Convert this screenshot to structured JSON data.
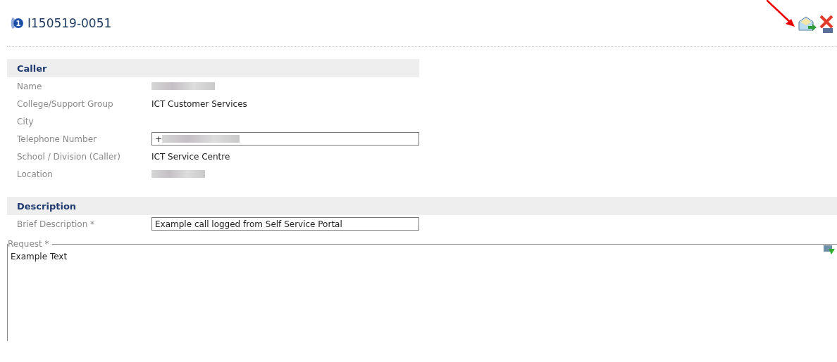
{
  "header": {
    "badge": "1",
    "title": "I150519-0051"
  },
  "sections": [
    {
      "title": "Caller",
      "wide": false,
      "fields": [
        {
          "label": "Name",
          "kind": "text",
          "redacted": true
        },
        {
          "label": "College/Support Group",
          "kind": "text",
          "value": "ICT Customer Services"
        },
        {
          "label": "City",
          "kind": "empty"
        },
        {
          "label": "Telephone Number",
          "kind": "input",
          "value": "+",
          "redacted": true
        },
        {
          "label": "School / Division (Caller)",
          "kind": "text",
          "value": "ICT Service Centre"
        },
        {
          "label": "Location",
          "kind": "text",
          "redacted": true
        }
      ]
    },
    {
      "title": "Description",
      "wide": true,
      "fields": [
        {
          "label": "Brief Description *",
          "kind": "input",
          "value": "Example call logged from Self Service Portal"
        }
      ]
    }
  ],
  "request": {
    "legend": "Request *",
    "value": "Example Text"
  }
}
